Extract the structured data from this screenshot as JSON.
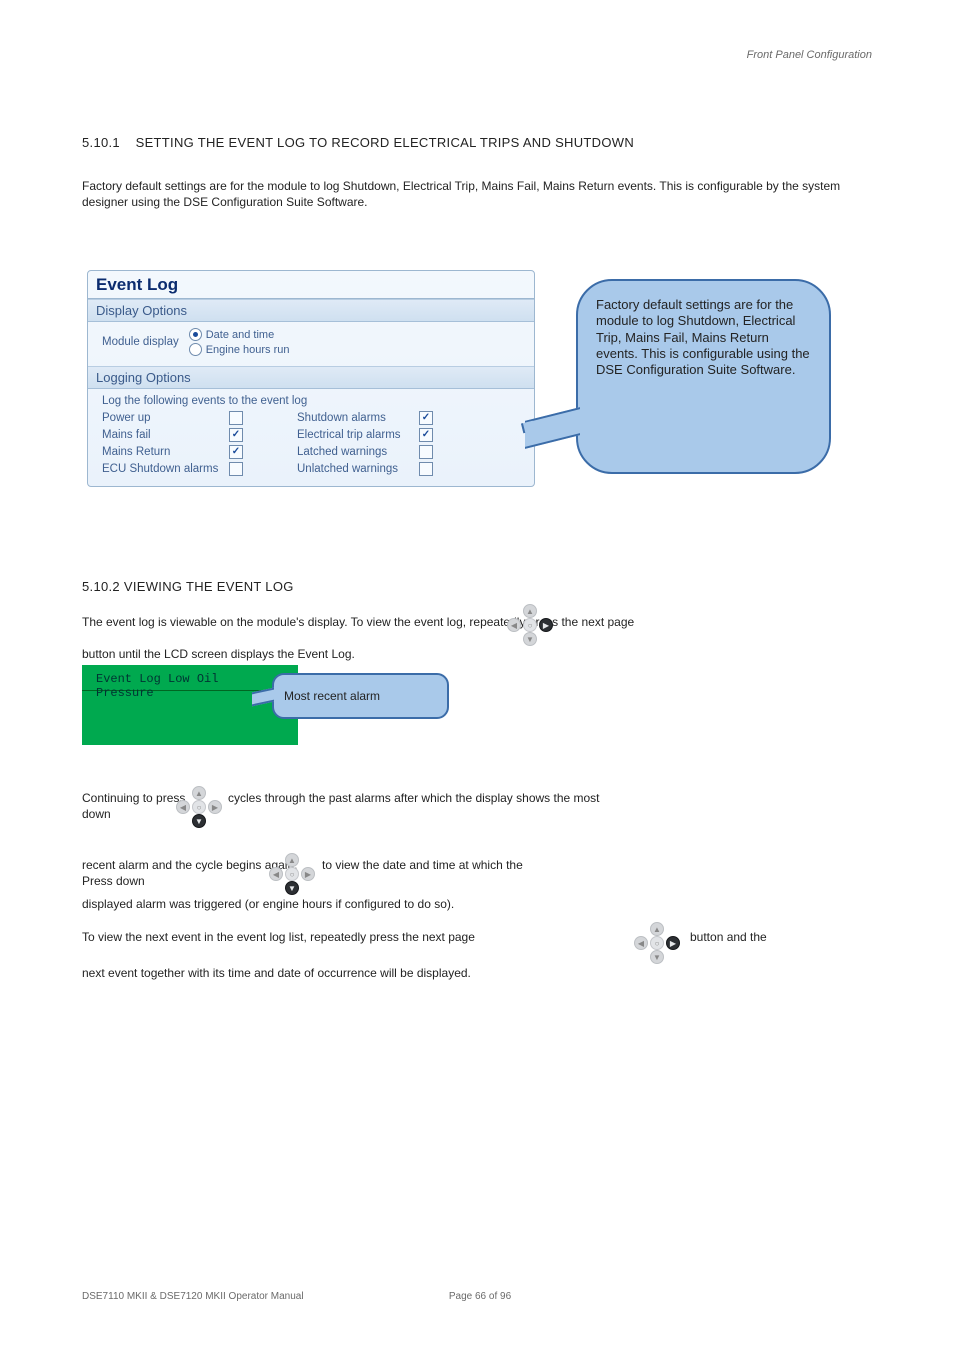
{
  "doc": {
    "page_label": "Front Panel Configuration",
    "breadcrumb": "DSE7110 MKII & DSE7120 MKII Operator Manual",
    "page_number": "Page 66 of 96",
    "section_no": "5.10.1",
    "section_title": "SETTING THE EVENT LOG TO RECORD ELECTRICAL TRIPS AND SHUTDOWN"
  },
  "panel": {
    "title": "Event Log",
    "display_options": {
      "header": "Display Options",
      "label": "Module display",
      "radios": [
        {
          "label": "Date and time",
          "selected": true
        },
        {
          "label": "Engine hours run",
          "selected": false
        }
      ]
    },
    "logging_options": {
      "header": "Logging Options",
      "intro": "Log the following events to the event log",
      "left": [
        {
          "label": "Power up",
          "checked": false
        },
        {
          "label": "Mains fail",
          "checked": true
        },
        {
          "label": "Mains Return",
          "checked": true
        },
        {
          "label": "ECU Shutdown alarms",
          "checked": false
        }
      ],
      "right": [
        {
          "label": "Shutdown alarms",
          "checked": true
        },
        {
          "label": "Electrical trip alarms",
          "checked": true
        },
        {
          "label": "Latched warnings",
          "checked": false
        },
        {
          "label": "Unlatched warnings",
          "checked": false
        }
      ]
    }
  },
  "callout_right": "Factory default settings are for the module to log Shutdown, Electrical Trip, Mains Fail, Mains Return events. This is configurable using the DSE Configuration Suite Software.",
  "body": {
    "p_intro": "Factory default settings are for the module to log Shutdown, Electrical Trip, Mains Fail, Mains Return events. This is configurable by the system designer using the DSE Configuration Suite Software.",
    "viewing_title": "5.10.2    VIEWING THE EVENT LOG",
    "viewing_p1": "The event log is viewable on the module's display. To view the event log, repeatedly press the next page",
    "viewing_p1b": "button until the LCD screen displays the Event Log.",
    "green_text": "Event Log\n Low Oil Pressure",
    "small_callout": "Most recent alarm",
    "nav_p1_a": "Continuing to press down",
    "nav_p1_b": "cycles through the past alarms after which the display shows the most",
    "nav_p2_a": "recent alarm and the cycle begins again. Press down",
    "nav_p2_b": "to view the date and time at which the",
    "nav_p3": "displayed alarm was triggered (or engine hours if configured to do so).",
    "nav_p4_a": "To view the next event in the event log list, repeatedly press the next page",
    "nav_p4_b": "button and the",
    "nav_p5": "next event together with its time and date of occurrence will be displayed."
  },
  "icons": {
    "up": "▲",
    "down": "▼",
    "left": "◀",
    "right": "▶",
    "center": "○"
  }
}
